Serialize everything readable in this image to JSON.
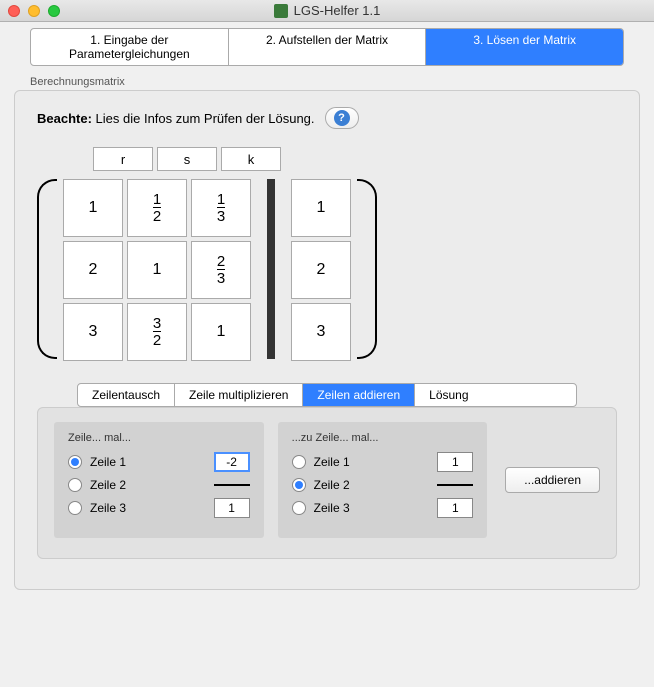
{
  "window": {
    "title": "LGS-Helfer 1.1"
  },
  "mainTabs": [
    {
      "label": "1. Eingabe der Parametergleichungen",
      "active": false
    },
    {
      "label": "2. Aufstellen der Matrix",
      "active": false
    },
    {
      "label": "3. Lösen der Matrix",
      "active": true
    }
  ],
  "groupLabel": "Berechnungsmatrix",
  "notice": {
    "bold": "Beachte:",
    "text": "Lies die Infos zum Prüfen der Lösung.",
    "help": "?"
  },
  "columns": [
    "r",
    "s",
    "k"
  ],
  "matrix": {
    "left": [
      [
        "1",
        "1/2",
        "1/3"
      ],
      [
        "2",
        "1",
        "2/3"
      ],
      [
        "3",
        "3/2",
        "1"
      ]
    ],
    "right": [
      "1",
      "2",
      "3"
    ]
  },
  "subTabs": [
    {
      "label": "Zeilentausch",
      "active": false
    },
    {
      "label": "Zeile multiplizieren",
      "active": false
    },
    {
      "label": "Zeilen addieren",
      "active": true
    },
    {
      "label": "Lösung",
      "active": false
    }
  ],
  "leftCol": {
    "header": "Zeile... mal...",
    "rows": [
      {
        "label": "Zeile 1",
        "checked": true,
        "value": "-2",
        "focused": true
      },
      {
        "label": "Zeile 2",
        "checked": false,
        "value": "",
        "focused": false,
        "bar": true
      },
      {
        "label": "Zeile 3",
        "checked": false,
        "value": "1",
        "focused": false
      }
    ]
  },
  "rightCol": {
    "header": "...zu Zeile... mal...",
    "rows": [
      {
        "label": "Zeile 1",
        "checked": false,
        "value": "1",
        "focused": false
      },
      {
        "label": "Zeile 2",
        "checked": true,
        "value": "",
        "focused": false,
        "bar": true
      },
      {
        "label": "Zeile 3",
        "checked": false,
        "value": "1",
        "focused": false
      }
    ]
  },
  "addButton": "...addieren"
}
